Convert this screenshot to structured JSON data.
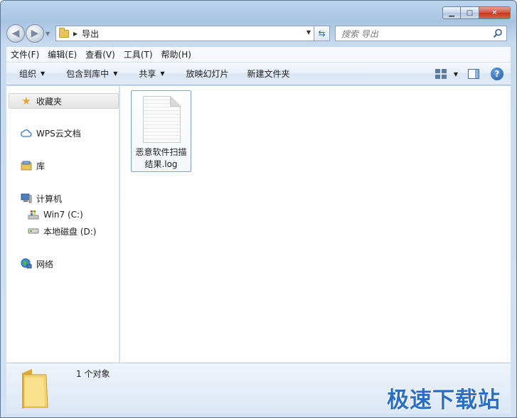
{
  "window": {
    "controls": {
      "minimize": "▁",
      "maximize": "□",
      "close": "✕"
    }
  },
  "address": {
    "path": "导出",
    "search_placeholder": "搜索 导出"
  },
  "menu": [
    "文件(F)",
    "编辑(E)",
    "查看(V)",
    "工具(T)",
    "帮助(H)"
  ],
  "commands": {
    "organize": "组织",
    "include": "包含到库中",
    "share": "共享",
    "slideshow": "放映幻灯片",
    "new_folder": "新建文件夹"
  },
  "nav": {
    "favorites": "收藏夹",
    "wps": "WPS云文档",
    "library": "库",
    "computer": "计算机",
    "drive_c": "Win7 (C:)",
    "drive_d": "本地磁盘 (D:)",
    "network": "网络"
  },
  "files": [
    {
      "name": "恶意软件扫描\n结果.log"
    }
  ],
  "status": {
    "count": "1 个对象"
  },
  "watermark": "极速下载站",
  "colors": {
    "accent": "#2a6fc4",
    "selection_border": "#7da2ce"
  }
}
